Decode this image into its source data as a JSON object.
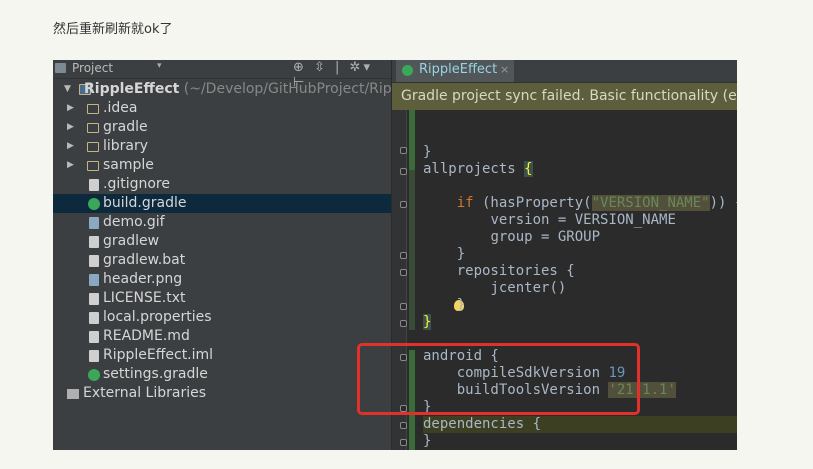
{
  "caption": "然后重新刷新就ok了",
  "project_panel": {
    "title": "Project",
    "dropdown_glyph": "▾",
    "tools": "⊕ ⇳ | ✲▾ ⊢",
    "root": {
      "name": "RippleEffect",
      "path": "(~/Develop/GitHubProject/RippleEffect)"
    },
    "items": [
      {
        "label": ".idea",
        "type": "folder",
        "expandable": true
      },
      {
        "label": "gradle",
        "type": "folder",
        "expandable": true
      },
      {
        "label": "library",
        "type": "folder",
        "expandable": true
      },
      {
        "label": "sample",
        "type": "folder",
        "expandable": true
      },
      {
        "label": ".gitignore",
        "type": "file"
      },
      {
        "label": "build.gradle",
        "type": "gradle",
        "selected": true
      },
      {
        "label": "demo.gif",
        "type": "image"
      },
      {
        "label": "gradlew",
        "type": "file"
      },
      {
        "label": "gradlew.bat",
        "type": "file"
      },
      {
        "label": "header.png",
        "type": "image"
      },
      {
        "label": "LICENSE.txt",
        "type": "file"
      },
      {
        "label": "local.properties",
        "type": "file"
      },
      {
        "label": "README.md",
        "type": "file"
      },
      {
        "label": "RippleEffect.iml",
        "type": "file"
      },
      {
        "label": "settings.gradle",
        "type": "gradle"
      }
    ],
    "external_libraries": "External Libraries"
  },
  "editor": {
    "tab_label": "RippleEffect",
    "tab_close": "×",
    "notification": "Gradle project sync failed. Basic functionality (e.g. editing, debugging) will not work properly."
  },
  "code_text": {
    "l_close": "}",
    "allprojects": "allprojects ",
    "open_brace": "{",
    "if_kw": "if",
    "has_prop": " (hasProperty(",
    "version_name_str": "\"VERSION_NAME\"",
    "close_paren_brace": ")) {",
    "version_line": "version = VERSION_NAME",
    "group_line": "group = GROUP",
    "repos": "repositories {",
    "jcenter": "jcenter()",
    "android": "android {",
    "compile_sdk": "compileSdkVersion ",
    "compile_sdk_val": "19",
    "build_tools": "buildToolsVersion ",
    "build_tools_val": "'21.1.1'",
    "dependencies": "dependencies {"
  },
  "colors": {
    "ide_bg": "#2b2b2b",
    "panel_bg": "#3c3f41",
    "selection": "#0d293e",
    "keyword": "#cc7832",
    "string": "#6a8759",
    "number": "#6897bb",
    "highlight_box": "#e0312a",
    "notification_bg": "#5c5e3c"
  }
}
